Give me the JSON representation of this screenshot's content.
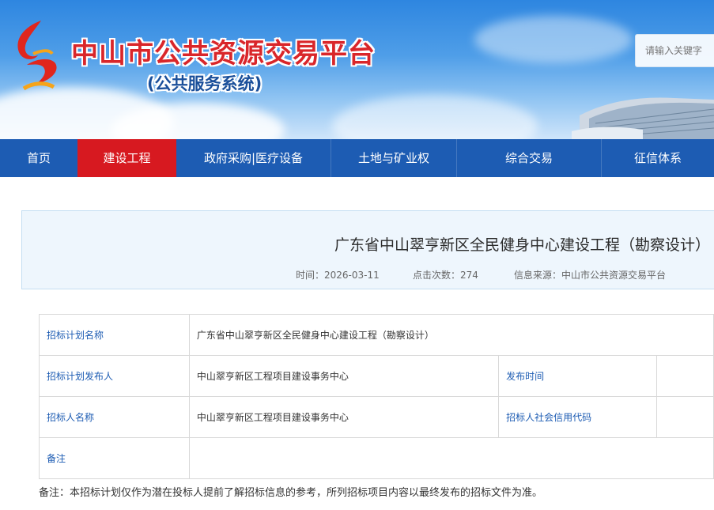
{
  "site": {
    "title": "中山市公共资源交易平台",
    "subtitle": "(公共服务系统)",
    "search_placeholder": "请输入关键字"
  },
  "nav": {
    "items": [
      {
        "label": "首页",
        "active": false
      },
      {
        "label": "建设工程",
        "active": true
      },
      {
        "label": "政府采购|医疗设备",
        "active": false
      },
      {
        "label": "土地与矿业权",
        "active": false
      },
      {
        "label": "综合交易",
        "active": false
      },
      {
        "label": "征信体系",
        "active": false
      }
    ]
  },
  "article": {
    "title": "广东省中山翠亨新区全民健身中心建设工程（勘察设计）",
    "time": "时间：2026-03-11",
    "clicks": "点击次数：274",
    "source": "信息来源：中山市公共资源交易平台"
  },
  "table": {
    "plan_name_label": "招标计划名称",
    "plan_name_value": "广东省中山翠亨新区全民健身中心建设工程（勘察设计）",
    "publisher_label": "招标计划发布人",
    "publisher_value": "中山翠亨新区工程项目建设事务中心",
    "publish_time_label": "发布时间",
    "publish_time_value": "",
    "tenderer_label": "招标人名称",
    "tenderer_value": "中山翠亨新区工程项目建设事务中心",
    "credit_code_label": "招标人社会信用代码",
    "credit_code_value": "",
    "remark_label": "备注",
    "remark_value": ""
  },
  "note": "备注：本招标计划仅作为潜在投标人提前了解招标信息的参考，所列招标项目内容以最终发布的招标文件为准。",
  "colors": {
    "nav_bg": "#1d5cb3",
    "nav_active": "#d71920",
    "label_text": "#1d5cb3",
    "title_red": "#d9262a"
  }
}
